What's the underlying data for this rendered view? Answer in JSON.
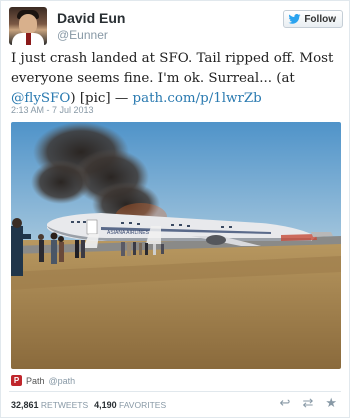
{
  "user": {
    "name": "David Eun",
    "handle": "@Eunner"
  },
  "follow_button": {
    "label": "Follow"
  },
  "tweet": {
    "text_before_mention": "I just crash landed at SFO. Tail ripped off. Most everyone seems fine. I'm ok. Surreal... (at ",
    "mention": "@flySFO",
    "text_after_mention": ") [pic] — ",
    "link": "path.com/p/1lwrZb",
    "timestamp": "2:13 AM - 7 Jul 2013"
  },
  "photo": {
    "plane_livery_text": "ASIANA AIRLINES"
  },
  "attribution": {
    "source_name": "Path",
    "source_handle": "@path",
    "logo_letter": "P"
  },
  "stats": {
    "retweets_count": "32,861",
    "retweets_label": "RETWEETS",
    "favorites_count": "4,190",
    "favorites_label": "FAVORITES"
  },
  "actions": {
    "reply_icon": "↩",
    "retweet_icon": "⇄",
    "favorite_icon": "★"
  },
  "colors": {
    "link": "#2a7ab0",
    "muted": "#8899a6",
    "path_brand": "#c0262c"
  }
}
